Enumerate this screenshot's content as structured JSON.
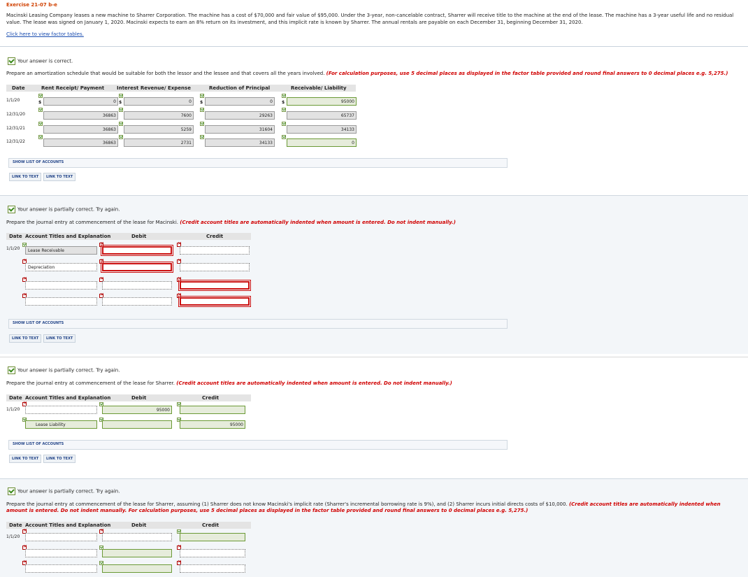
{
  "exercise_title": "Exercise 21-07 b-e",
  "problem_text": "Macinski Leasing Company leases a new machine to Sharrer Corporation. The machine has a cost of $70,000 and fair value of $95,000. Under the 3-year, non-cancelable contract, Sharrer will receive title to the machine at the end of the lease. The machine has a 3-year useful life and no residual value. The lease was signed on January 1, 2020. Macinski expects to earn an 8% return on its investment, and this implicit rate is known by Sharrer. The annual rentals are payable on each December 31, beginning December 31, 2020.",
  "factor_link": "Click here to view factor tables.",
  "buttons": {
    "show_accounts": "SHOW LIST OF ACCOUNTS",
    "link_text": "LINK TO TEXT"
  },
  "section1": {
    "status": "Your answer is correct.",
    "instruction": "Prepare an amortization schedule that would be suitable for both the lessor and the lessee and that covers all the years involved.",
    "instruction_red": "(For calculation purposes, use 5 decimal places as displayed in the factor table provided and round final answers to 0 decimal places e.g. 5,275.)",
    "headers": [
      "Date",
      "Rent Receipt/ Payment",
      "Interest Revenue/ Expense",
      "Reduction of Principal",
      "Receivable/ Liability"
    ],
    "rows": [
      {
        "date": "1/1/20",
        "rent": "0",
        "interest": "0",
        "reduction": "0",
        "balance": "95000"
      },
      {
        "date": "12/31/20",
        "rent": "36863",
        "interest": "7600",
        "reduction": "29263",
        "balance": "65737"
      },
      {
        "date": "12/31/21",
        "rent": "36863",
        "interest": "5259",
        "reduction": "31604",
        "balance": "34133"
      },
      {
        "date": "12/31/22",
        "rent": "36863",
        "interest": "2731",
        "reduction": "34133",
        "balance": "0"
      }
    ]
  },
  "section2": {
    "status": "Your answer is partially correct.  Try again.",
    "instruction": "Prepare the journal entry at commencement of the lease for Macinski.",
    "instruction_red": "(Credit account titles are automatically indented when amount is entered. Do not indent manually.)",
    "headers": [
      "Date",
      "Account Titles and Explanation",
      "Debit",
      "Credit"
    ],
    "date": "1/1/20",
    "accounts": [
      "Lease Receivable",
      "Depreciation",
      "",
      ""
    ]
  },
  "section3": {
    "status": "Your answer is partially correct.  Try again.",
    "instruction": "Prepare the journal entry at commencement of the lease for Sharrer.",
    "instruction_red": "(Credit account titles are automatically indented when amount is entered. Do not indent manually.)",
    "headers": [
      "Date",
      "Account Titles and Explanation",
      "Debit",
      "Credit"
    ],
    "date": "1/1/20",
    "debit": "95000",
    "credit": "95000",
    "credit_account": "Lease Liability"
  },
  "section4": {
    "status": "Your answer is partially correct.  Try again.",
    "instruction": "Prepare the journal entry at commencement of the lease for Sharrer, assuming (1) Sharrer does not know Macinski's implicit rate (Sharrer's incremental borrowing rate is 9%), and (2) Sharrer incurs initial directs costs of $10,000.",
    "instruction_red": "(Credit account titles are automatically indented when amount is entered. Do not indent manually. For calculation purposes, use 5 decimal places as displayed in the factor table provided and round final answers to 0 decimal places e.g. 5,275.)",
    "headers": [
      "Date",
      "Account Titles and Explanation",
      "Debit",
      "Credit"
    ],
    "date": "1/1/20"
  }
}
